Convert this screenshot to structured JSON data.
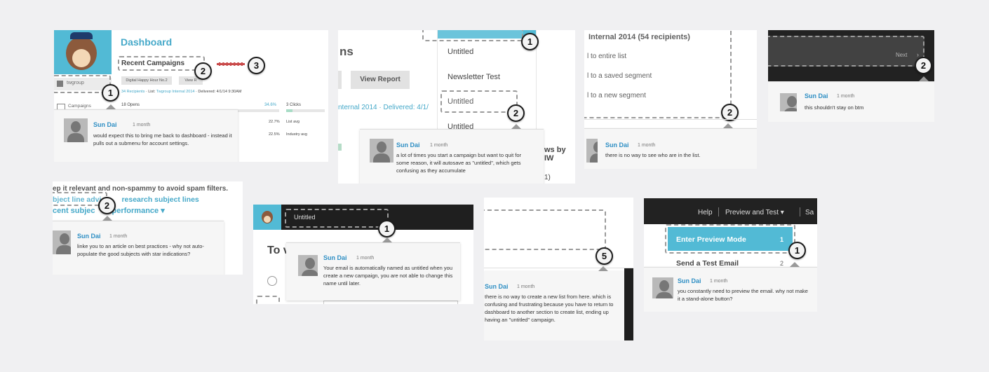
{
  "colors": {
    "accent": "#52bad5",
    "dark_bar": "#1f1f1f",
    "marker_bg": "#f4f4f4",
    "comment_user": "#2f8fc4"
  },
  "tiles": [
    {
      "header": {
        "title": "Dashboard",
        "section": "Recent Campaigns",
        "list_item": "twgroup",
        "nav_item": "Campaigns",
        "campaign_btn": "Digital Happy Hour No.2",
        "view_btn": "View R",
        "stats_line": {
          "recipients": "34 Recipients",
          "list_label": "List:",
          "list": "Twgroup Internal 2014",
          "delivered": "Delivered: 4/1/14 9:30AM"
        },
        "opens": "18 Opens",
        "opens_pct": "34.6%",
        "clicks": "3 Clicks",
        "list_avg_pct": "22.7%",
        "list_avg": "List avg",
        "industry_pct": "22.5%",
        "industry": "Industry avg"
      },
      "markers": [
        "1",
        "2",
        "3"
      ],
      "comment": {
        "user": "Sun Dai",
        "time": "1 month",
        "text": "would expect this to bring me back to dashboard - instead it pulls out a submenu for account settings."
      }
    },
    {
      "bg": {
        "heading": "ns",
        "view_report": "View Report",
        "delivered_line": "nternal 2014 · Delivered: 4/1/",
        "right_text": "ws by IW",
        "right_text2": "1)"
      },
      "menu": [
        "Untitled",
        "Newsletter Test",
        "Untitled",
        "Untitled"
      ],
      "markers": [
        "1",
        "2"
      ],
      "comment": {
        "user": "Sun Dai",
        "time": "1 month",
        "text": "a lot of times you start a campaign but want to quit for some reason, it will autosave as \"untitled\", which gets confusing as they accumulate"
      }
    },
    {
      "bg": {
        "heading": "Internal 2014 (54 recipients)",
        "options": [
          "l to entire list",
          "l to a saved segment",
          "l to a new segment"
        ]
      },
      "markers": [
        "2"
      ],
      "comment": {
        "user": "Sun Dai",
        "time": "1 month",
        "text": "there is no way to see who are in the list."
      }
    },
    {
      "bar": {
        "next": "Next"
      },
      "markers": [
        "2"
      ],
      "comment": {
        "user": "Sun Dai",
        "time": "1 month",
        "text": "this shouldn't stay on btm"
      }
    },
    {
      "bg": {
        "line1": "ep it relevant and non-spammy to avoid spam filters.",
        "line2a": "bject line advi",
        "line2b": "research subject lines",
        "line3a": "cent subjec",
        "line3b": "performance ▾"
      },
      "markers": [
        "2"
      ],
      "comment": {
        "user": "Sun Dai",
        "time": "1 month",
        "text": "linke you to an article on best practices - why not auto-populate the good subjects with star indications?"
      }
    },
    {
      "bar": {
        "name": "Untitled",
        "heading": "To v"
      },
      "markers": [
        "1"
      ],
      "comment": {
        "user": "Sun Dai",
        "time": "1 month",
        "text": "Your email is automatically named as untitled when you create a new campaign, you are not able to change this name until later."
      }
    },
    {
      "markers": [
        "5"
      ],
      "comment": {
        "user": "Sun Dai",
        "time": "1 month",
        "text": "there is no way to create a new list from here. which is confusing and frustrating because you have to return to dashboard to another section to create list, ending up having an \"untitled\" campaign."
      }
    },
    {
      "bar": {
        "help": "Help",
        "preview": "Preview and Test ▾",
        "save": "Sa"
      },
      "menu": [
        {
          "label": "Enter Preview Mode",
          "key": "1"
        },
        {
          "label": "Send a Test Email",
          "key": "2"
        }
      ],
      "markers": [
        "1"
      ],
      "comment": {
        "user": "Sun Dai",
        "time": "1 month",
        "text": "you constantly need to preview the email. why not make it a stand-alone button?"
      }
    }
  ]
}
